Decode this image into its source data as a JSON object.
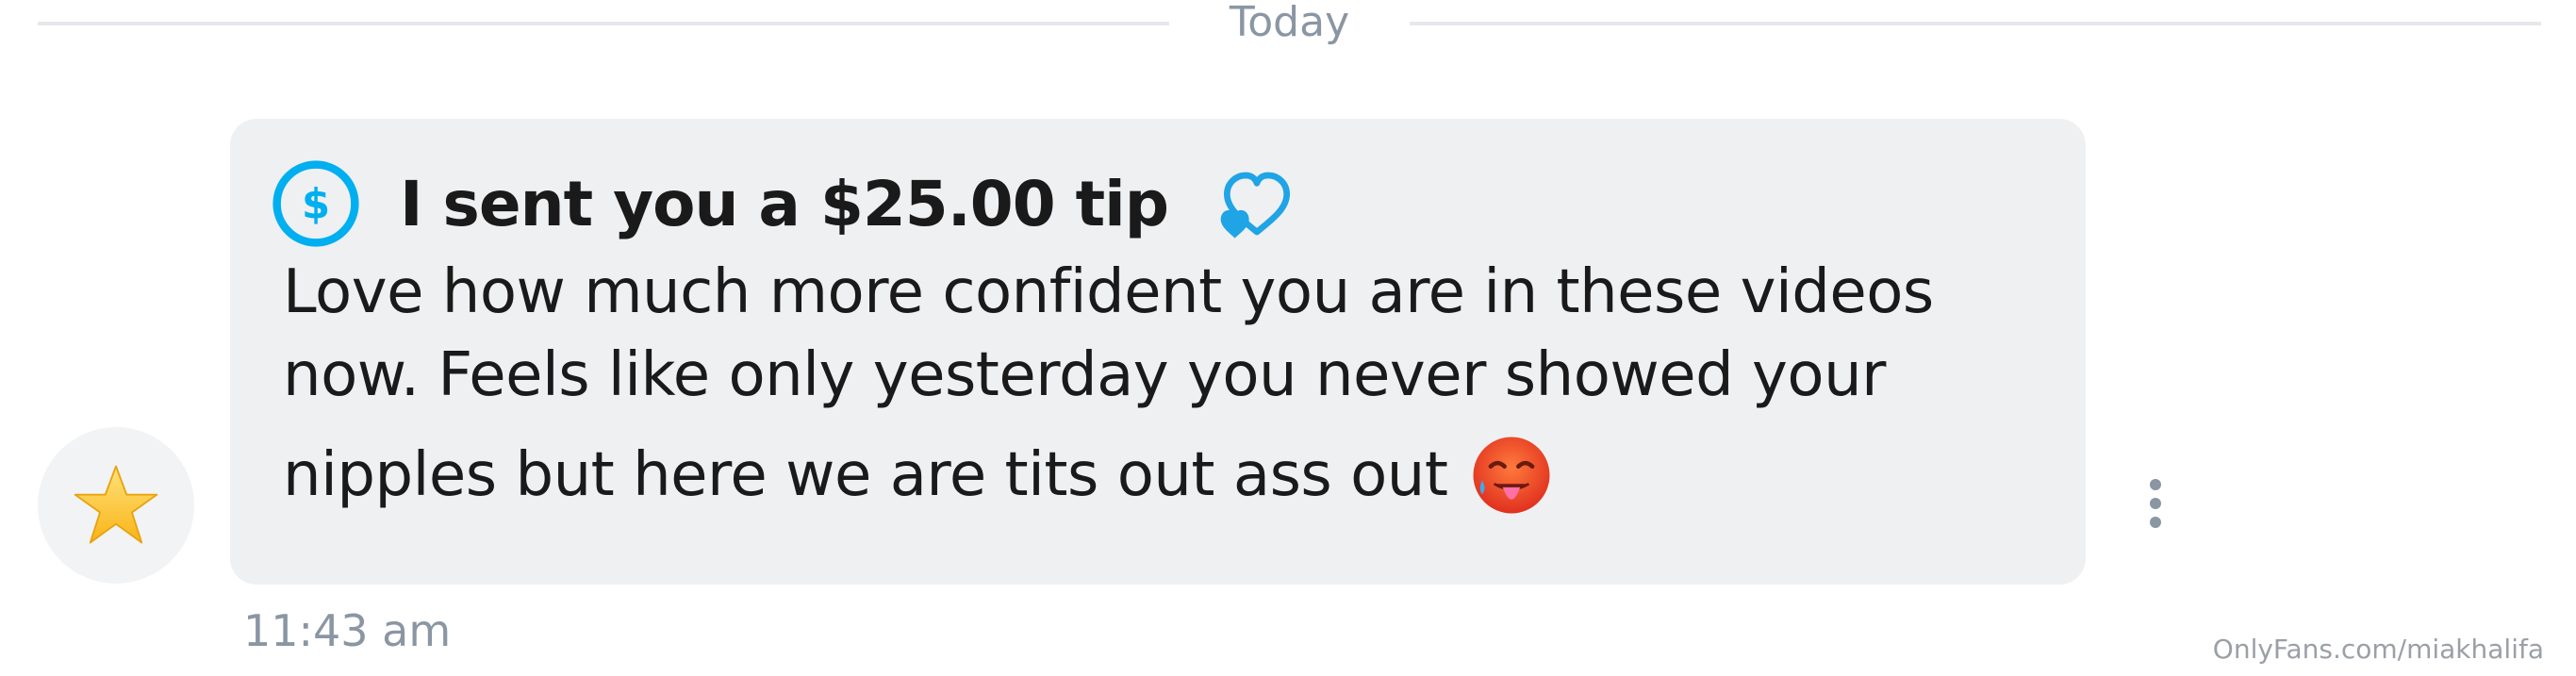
{
  "divider": {
    "label": "Today"
  },
  "avatar": {
    "icon": "star-icon",
    "background": "#f2f3f5"
  },
  "message": {
    "tip": {
      "icon": "dollar-icon",
      "text": "I sent you a $25.00 tip",
      "reaction_icon": "heart-icon",
      "accent": "#00aff0"
    },
    "lines": [
      "Love how much more confident you are in these videos",
      "now. Feels like only yesterday you never showed your",
      "nipples but here we are tits out ass out"
    ],
    "emoji": "hot-face-emoji-icon",
    "bubble_color": "#eff0f2"
  },
  "actions": {
    "more_icon": "kebab-menu-icon"
  },
  "time": "11:43 am",
  "watermark": "OnlyFans.com/miakhalifa"
}
